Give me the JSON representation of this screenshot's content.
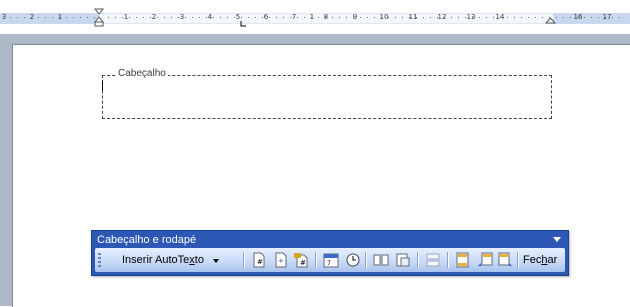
{
  "ruler": {
    "labels": [
      "3",
      "2",
      "1",
      "1",
      "1",
      "2",
      "3",
      "4",
      "5",
      "6",
      "7",
      "1",
      "8",
      "9",
      "10",
      "11",
      "12",
      "13",
      "14",
      "16",
      "17"
    ]
  },
  "document": {
    "header_label": "Cabeçalho"
  },
  "toolbar": {
    "title": "Cabeçalho e rodapé",
    "autotext_prefix": "Inserir AutoTe",
    "autotext_mnemonic": "x",
    "autotext_suffix": "to",
    "close_prefix": "Fec",
    "close_mnemonic": "h",
    "close_suffix": "ar",
    "buttons": [
      {
        "name": "insert-page-number",
        "icon": "page-number-icon"
      },
      {
        "name": "insert-page-count",
        "icon": "page-count-icon"
      },
      {
        "name": "format-page-number",
        "icon": "format-page-number-icon"
      },
      {
        "name": "insert-date",
        "icon": "date-icon"
      },
      {
        "name": "insert-time",
        "icon": "clock-icon"
      },
      {
        "name": "page-setup",
        "icon": "page-setup-icon"
      },
      {
        "name": "show-hide-text",
        "icon": "show-text-icon"
      },
      {
        "name": "same-as-previous",
        "icon": "link-previous-icon"
      },
      {
        "name": "switch-header-footer",
        "icon": "switch-header-footer-icon"
      },
      {
        "name": "show-previous",
        "icon": "show-previous-icon"
      },
      {
        "name": "show-next",
        "icon": "show-next-icon"
      }
    ]
  },
  "colors": {
    "toolbar_title_bar": "#2c57b5",
    "ruler_margin": "#c7d8ef",
    "workspace": "#aeb9c8"
  }
}
